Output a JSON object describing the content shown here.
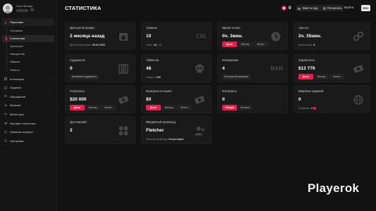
{
  "profile": {
    "name": "Олег Фолгун"
  },
  "menu": {
    "group_personal": "Персонаж",
    "sub_items": [
      "Основное",
      "Статистика",
      "Транспорт",
      "Имущество",
      "Навыки",
      "Работы"
    ],
    "selected_sub": "Статистика",
    "items": [
      "Коллекции",
      "Задания",
      "Обращения",
      "Магазин",
      "Мини-игры",
      "Игровая статистика",
      "Правила сервера",
      "Настройки"
    ]
  },
  "header": {
    "title": "СТАТИСТИКА",
    "coins": "0",
    "redeem_label": "Ввести код",
    "topup_label": "Пополнить",
    "exit_label": "Выйти",
    "esc_label": "ESC"
  },
  "tabs": {
    "day": "День",
    "month": "Месяц",
    "all": "Всего",
    "general": "Общие",
    "personal": "Личные"
  },
  "cards": {
    "registration": {
      "label": "Дата регистрации",
      "value": "2 месяца назад",
      "sub_label": "Дата регистрации:",
      "sub_value": "05.01.2026"
    },
    "level": {
      "label": "Уровень",
      "value": "10",
      "sub_label": "Опыт:",
      "sub_value": "43",
      "sub_total": "/ 44",
      "icon_text": "LVL"
    },
    "playtime": {
      "label": "Время в игре",
      "value": "0ч. 3мин."
    },
    "arrests": {
      "label": "Аресты",
      "value": "2ч. 35мин.",
      "sub_label": "Количество:",
      "sub_value": "5"
    },
    "convictions": {
      "label": "Судимости",
      "value": "0",
      "chip": "Активные судимости"
    },
    "kills": {
      "label": "Убийства",
      "value": "48",
      "sub_label": "Смерти:",
      "sub_value": "230"
    },
    "blocks": {
      "label": "Блокировки",
      "value": "4",
      "chip": "История блокировок",
      "icon_text": "BAN"
    },
    "earned": {
      "label": "Заработано",
      "value": "$12 779"
    },
    "spent": {
      "label": "Потрачено",
      "value": "$20 000"
    },
    "casino": {
      "label": "Выиграно в казино",
      "value": "$0"
    },
    "contracts": {
      "label": "Контракты",
      "value": "0"
    },
    "world_tasks": {
      "label": "Мировых заданий",
      "value": "0",
      "sub_label": "Получено:",
      "sub_value": "0"
    },
    "achievements": {
      "label": "Достижений",
      "value": "2"
    },
    "promo": {
      "label": "Введённый промокод",
      "value": "Fletcher",
      "sub_label": "Личный промокод:",
      "sub_value": "Отсутствует"
    }
  },
  "brand": "Playerok",
  "colors": {
    "accent": "#e3214b",
    "background": "#121212",
    "card": "#1a1a1a"
  }
}
